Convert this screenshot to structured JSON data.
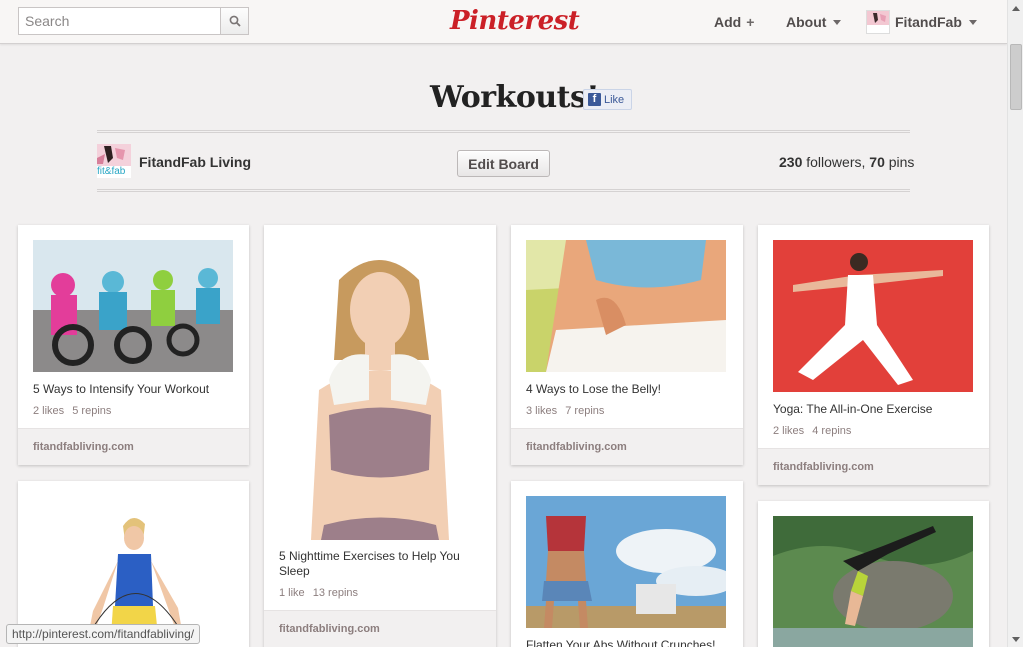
{
  "header": {
    "search_placeholder": "Search",
    "logo_text": "Pinterest",
    "nav_add": "Add",
    "nav_about": "About",
    "nav_user": "FitandFab"
  },
  "board": {
    "title": "Workouts!",
    "fb_like_label": "Like",
    "owner_name": "FitandFab Living",
    "edit_label": "Edit Board",
    "followers_count": "230",
    "followers_label": "followers,",
    "pins_count": "70",
    "pins_label": "pins"
  },
  "avatar_text": "fit&fab",
  "pins": [
    {
      "description": "5 Ways to Intensify Your Workout",
      "likes": "2 likes",
      "repins": "5 repins",
      "source": "fitandfabliving.com"
    },
    {
      "description": "5 Nighttime Exercises to Help You Sleep",
      "likes": "1 like",
      "repins": "13 repins",
      "source": "fitandfabliving.com"
    },
    {
      "description": "4 Ways to Lose the Belly!",
      "likes": "3 likes",
      "repins": "7 repins",
      "source": "fitandfabliving.com"
    },
    {
      "description": "Yoga: The All-in-One Exercise",
      "likes": "2 likes",
      "repins": "4 repins",
      "source": "fitandfabliving.com"
    },
    {
      "description": "Flatten Your Abs Without Crunches!"
    }
  ],
  "status_bar_url": "http://pinterest.com/fitandfabliving/",
  "colors": {
    "brand_red": "#cb2027",
    "page_bg": "#f2f0f0",
    "facebook_blue": "#3b5998"
  }
}
